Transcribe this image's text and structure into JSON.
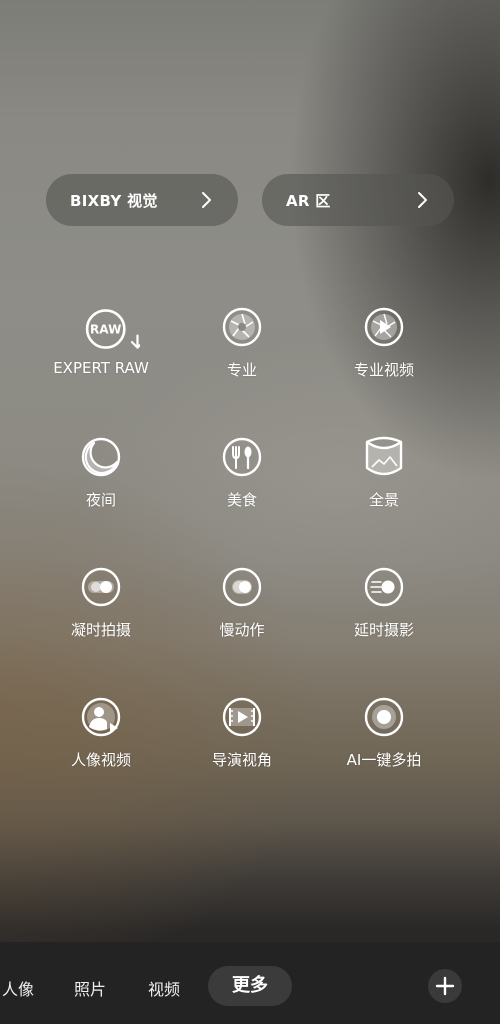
{
  "shortcuts": [
    {
      "label": "BIXBY 视觉",
      "icon": "chevron-right-icon"
    },
    {
      "label": "AR 区",
      "icon": "chevron-right-icon"
    }
  ],
  "modes": [
    {
      "label": "EXPERT RAW",
      "icon": "raw-download-icon",
      "icon_text": "RAW"
    },
    {
      "label": "专业",
      "icon": "aperture-icon"
    },
    {
      "label": "专业视频",
      "icon": "aperture-play-icon"
    },
    {
      "label": "夜间",
      "icon": "moon-icon"
    },
    {
      "label": "美食",
      "icon": "fork-spoon-icon"
    },
    {
      "label": "全景",
      "icon": "panorama-icon"
    },
    {
      "label": "凝时拍摄",
      "icon": "hyperlapse-icon"
    },
    {
      "label": "慢动作",
      "icon": "slow-motion-icon"
    },
    {
      "label": "延时摄影",
      "icon": "timelapse-icon"
    },
    {
      "label": "人像视频",
      "icon": "portrait-video-icon"
    },
    {
      "label": "导演视角",
      "icon": "director-view-icon"
    },
    {
      "label": "AI一键多拍",
      "icon": "single-take-icon"
    }
  ],
  "bottom_tabs": [
    {
      "label": "人像"
    },
    {
      "label": "照片"
    },
    {
      "label": "视频"
    },
    {
      "label": "更多",
      "active": true
    }
  ],
  "add_button": {
    "icon": "plus-icon"
  }
}
